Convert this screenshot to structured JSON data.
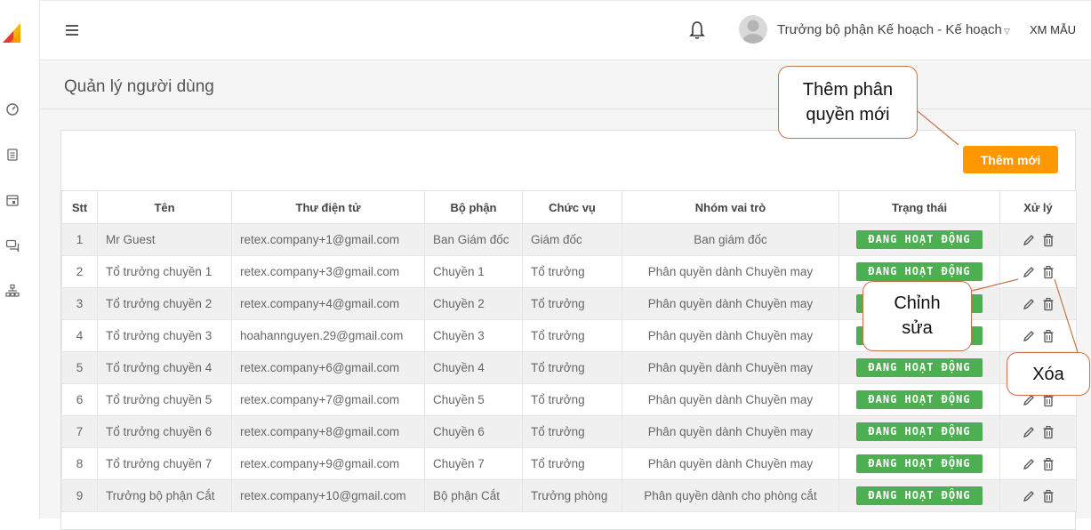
{
  "header": {
    "user_name": "Trưởng bộ phận Kế hoạch - Kế hoạch",
    "org": "XM MẪU"
  },
  "page": {
    "title": "Quản lý người dùng",
    "add_button": "Thêm mới"
  },
  "table": {
    "columns": [
      "Stt",
      "Tên",
      "Thư điện tử",
      "Bộ phận",
      "Chức vụ",
      "Nhóm vai trò",
      "Trạng thái",
      "Xử lý"
    ],
    "rows": [
      {
        "stt": "1",
        "name": "Mr Guest",
        "email": "retex.company+1@gmail.com",
        "dept": "Ban Giám đốc",
        "position": "Giám đốc",
        "role": "Ban giám đốc",
        "status": "ĐANG HOẠT ĐỘNG"
      },
      {
        "stt": "2",
        "name": "Tổ trưởng chuyền 1",
        "email": "retex.company+3@gmail.com",
        "dept": "Chuyền 1",
        "position": "Tổ trưởng",
        "role": "Phân quyền dành Chuyền may",
        "status": "ĐANG HOẠT ĐỘNG"
      },
      {
        "stt": "3",
        "name": "Tổ trưởng chuyền 2",
        "email": "retex.company+4@gmail.com",
        "dept": "Chuyền 2",
        "position": "Tổ trưởng",
        "role": "Phân quyền dành Chuyền may",
        "status": "ĐANG HOẠT ĐỘNG"
      },
      {
        "stt": "4",
        "name": "Tổ trưởng chuyền 3",
        "email": "hoahannguyen.29@gmail.com",
        "dept": "Chuyền 3",
        "position": "Tổ trưởng",
        "role": "Phân quyền dành Chuyền may",
        "status": "ĐANG HOẠT ĐỘNG"
      },
      {
        "stt": "5",
        "name": "Tổ trưởng chuyền 4",
        "email": "retex.company+6@gmail.com",
        "dept": "Chuyền 4",
        "position": "Tổ trưởng",
        "role": "Phân quyền dành Chuyền may",
        "status": "ĐANG HOẠT ĐỘNG"
      },
      {
        "stt": "6",
        "name": "Tổ trưởng chuyền 5",
        "email": "retex.company+7@gmail.com",
        "dept": "Chuyền 5",
        "position": "Tổ trưởng",
        "role": "Phân quyền dành Chuyền may",
        "status": "ĐANG HOẠT ĐỘNG"
      },
      {
        "stt": "7",
        "name": "Tổ trưởng chuyền 6",
        "email": "retex.company+8@gmail.com",
        "dept": "Chuyền 6",
        "position": "Tổ trưởng",
        "role": "Phân quyền dành Chuyền may",
        "status": "ĐANG HOẠT ĐỘNG"
      },
      {
        "stt": "8",
        "name": "Tổ trưởng chuyền 7",
        "email": "retex.company+9@gmail.com",
        "dept": "Chuyền 7",
        "position": "Tổ trưởng",
        "role": "Phân quyền dành Chuyền may",
        "status": "ĐANG HOẠT ĐỘNG"
      },
      {
        "stt": "9",
        "name": "Trưởng bộ phận Cắt",
        "email": "retex.company+10@gmail.com",
        "dept": "Bộ phận Cắt",
        "position": "Trưởng phòng",
        "role": "Phân quyền dành cho phòng cắt",
        "status": "ĐANG HOẠT ĐỘNG"
      }
    ]
  },
  "annotations": {
    "add_permission": "Thêm phân quyền mới",
    "edit": "Chỉnh sửa",
    "delete": "Xóa"
  },
  "colors": {
    "accent": "#ff9800",
    "status_active": "#4caf50",
    "callout_border": "#c8724a"
  },
  "icons": [
    "menu-icon",
    "bell-icon",
    "dashboard-icon",
    "document-icon",
    "calendar-icon",
    "chat-icon",
    "org-chart-icon",
    "edit-icon",
    "trash-icon"
  ]
}
